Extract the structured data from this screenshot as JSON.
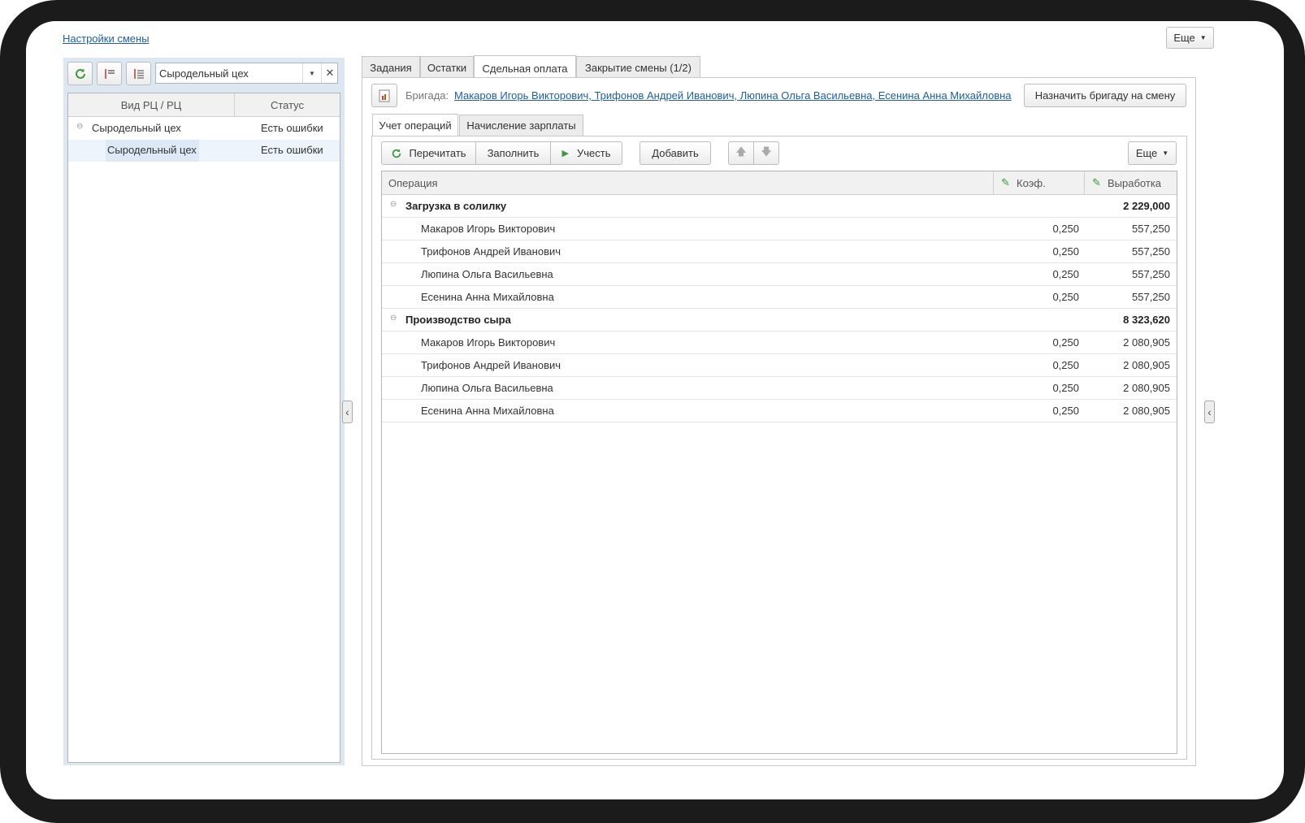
{
  "header": {
    "settings_link": "Настройки смены",
    "more_label": "Еще"
  },
  "left": {
    "filter_value": "Сыродельный цех",
    "columns": {
      "kind": "Вид РЦ / РЦ",
      "status": "Статус"
    },
    "rows": [
      {
        "name": "Сыродельный цех",
        "status": "Есть ошибки"
      },
      {
        "name": "Сыродельный цех",
        "status": "Есть ошибки"
      }
    ]
  },
  "tabs": [
    "Задания",
    "Остатки",
    "Сдельная оплата",
    "Закрытие смены (1/2)"
  ],
  "brigade": {
    "label": "Бригада:",
    "members": "Макаров Игорь Викторович, Трифонов Андрей Иванович, Люпина Ольга Васильевна, Есенина Анна Михайловна",
    "assign_button": "Назначить бригаду на смену"
  },
  "subtabs": [
    "Учет операций",
    "Начисление зарплаты"
  ],
  "toolbar": {
    "reread": "Перечитать",
    "fill": "Заполнить",
    "account": "Учесть",
    "add": "Добавить",
    "more": "Еще"
  },
  "table": {
    "columns": {
      "operation": "Операция",
      "coef": "Коэф.",
      "output": "Выработка"
    },
    "groups": [
      {
        "name": "Загрузка в солилку",
        "total": "2 229,000",
        "rows": [
          {
            "name": "Макаров Игорь Викторович",
            "coef": "0,250",
            "output": "557,250"
          },
          {
            "name": "Трифонов Андрей Иванович",
            "coef": "0,250",
            "output": "557,250"
          },
          {
            "name": "Люпина Ольга Васильевна",
            "coef": "0,250",
            "output": "557,250"
          },
          {
            "name": "Есенина Анна Михайловна",
            "coef": "0,250",
            "output": "557,250"
          }
        ]
      },
      {
        "name": "Производство сыра",
        "total": "8 323,620",
        "rows": [
          {
            "name": "Макаров Игорь Викторович",
            "coef": "0,250",
            "output": "2 080,905"
          },
          {
            "name": "Трифонов Андрей Иванович",
            "coef": "0,250",
            "output": "2 080,905"
          },
          {
            "name": "Люпина Ольга Васильевна",
            "coef": "0,250",
            "output": "2 080,905"
          },
          {
            "name": "Есенина Анна Михайловна",
            "coef": "0,250",
            "output": "2 080,905"
          }
        ]
      }
    ]
  },
  "colors": {
    "accent_green": "#3c9a3c",
    "link_blue": "#1f5ea8",
    "selection": "#dde9f6"
  }
}
